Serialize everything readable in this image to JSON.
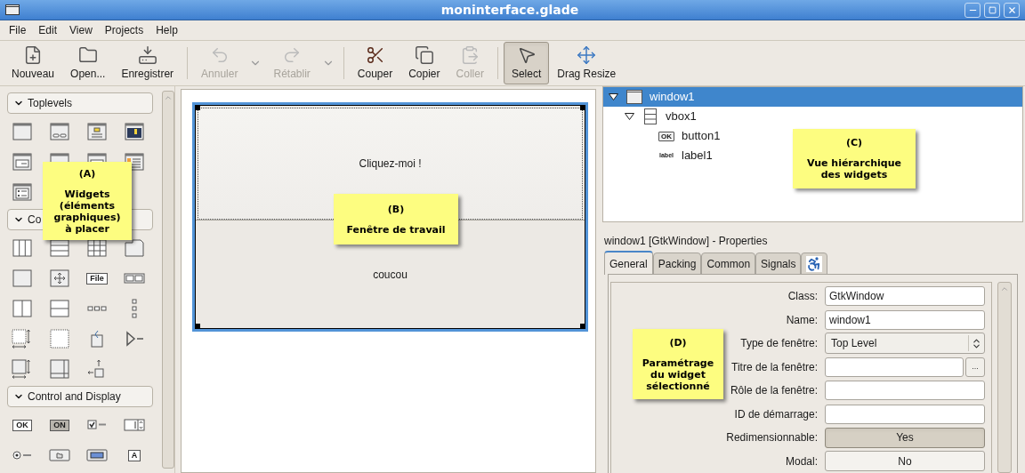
{
  "window": {
    "title": "moninterface.glade"
  },
  "menu": [
    "File",
    "Edit",
    "View",
    "Projects",
    "Help"
  ],
  "toolbar": [
    {
      "kind": "button",
      "label": "Nouveau",
      "disabled": false,
      "selected": false,
      "dropdown": false
    },
    {
      "kind": "button",
      "label": "Open...",
      "disabled": false,
      "selected": false,
      "dropdown": false
    },
    {
      "kind": "button",
      "label": "Enregistrer",
      "disabled": false,
      "selected": false,
      "dropdown": false
    },
    {
      "kind": "separator"
    },
    {
      "kind": "button",
      "label": "Annuler",
      "disabled": true,
      "selected": false,
      "dropdown": true
    },
    {
      "kind": "button",
      "label": "Rétablir",
      "disabled": true,
      "selected": false,
      "dropdown": true
    },
    {
      "kind": "separator"
    },
    {
      "kind": "button",
      "label": "Couper",
      "disabled": false,
      "selected": false,
      "dropdown": false
    },
    {
      "kind": "button",
      "label": "Copier",
      "disabled": false,
      "selected": false,
      "dropdown": false
    },
    {
      "kind": "button",
      "label": "Coller",
      "disabled": true,
      "selected": false,
      "dropdown": false
    },
    {
      "kind": "separator"
    },
    {
      "kind": "button",
      "label": "Select",
      "disabled": false,
      "selected": true,
      "dropdown": false
    },
    {
      "kind": "button",
      "label": "Drag Resize",
      "disabled": false,
      "selected": false,
      "dropdown": false
    }
  ],
  "palette": [
    {
      "title": "Toplevels",
      "expanded": true,
      "items": [
        {
          "kind": "window"
        },
        {
          "kind": "dialog"
        },
        {
          "kind": "message"
        },
        {
          "kind": "about"
        },
        {
          "kind": "form"
        },
        {
          "kind": "window"
        },
        {
          "kind": "form"
        },
        {
          "kind": "text-window"
        },
        {
          "kind": "list-window"
        }
      ]
    },
    {
      "title": "Co",
      "expanded": true,
      "items": [
        {
          "kind": "hbox"
        },
        {
          "kind": "vbox"
        },
        {
          "kind": "table"
        },
        {
          "kind": "notebook"
        },
        {
          "kind": "frame"
        },
        {
          "kind": "layout"
        },
        {
          "kind": "labeled",
          "text": "File"
        },
        {
          "kind": "toolbar"
        },
        {
          "kind": "hpaned"
        },
        {
          "kind": "vpaned"
        },
        {
          "kind": "hbuttons"
        },
        {
          "kind": "vbuttons"
        },
        {
          "kind": "dotted-resize"
        },
        {
          "kind": "dotted"
        },
        {
          "kind": "alignment"
        },
        {
          "kind": "expander"
        },
        {
          "kind": "fixed"
        },
        {
          "kind": "scrolled"
        },
        {
          "kind": "eventbox"
        }
      ]
    },
    {
      "title": "Control and Display",
      "expanded": true,
      "items": [
        {
          "kind": "labeled",
          "text": "OK"
        },
        {
          "kind": "pressed",
          "text": "ON"
        },
        {
          "kind": "check"
        },
        {
          "kind": "spin"
        },
        {
          "kind": "radio"
        },
        {
          "kind": "filechooser"
        },
        {
          "kind": "color"
        },
        {
          "kind": "labeled",
          "text": "A"
        }
      ]
    }
  ],
  "canvas": {
    "button": "Cliquez-moi !",
    "label": "coucou"
  },
  "tree": [
    {
      "label": "window1",
      "kind": "window",
      "selected": true,
      "expanded": true,
      "children": [
        {
          "label": "vbox1",
          "kind": "vbox",
          "selected": false,
          "expanded": true,
          "children": [
            {
              "label": "button1",
              "kind": "button",
              "icon_text": "OK",
              "selected": false
            },
            {
              "label": "label1",
              "kind": "label",
              "icon_text": "label",
              "selected": false
            }
          ]
        }
      ]
    }
  ],
  "properties": {
    "header": "window1 [GtkWindow] - Properties",
    "tabs": [
      {
        "kind": "text",
        "label": "General",
        "selected": true
      },
      {
        "kind": "text",
        "label": "Packing",
        "selected": false
      },
      {
        "kind": "text",
        "label": "Common",
        "selected": false
      },
      {
        "kind": "text",
        "label": "Signals",
        "selected": false
      },
      {
        "kind": "icon",
        "selected": false
      }
    ],
    "fields": [
      {
        "label": "Class:",
        "kind": "text",
        "value": "GtkWindow"
      },
      {
        "label": "Name:",
        "kind": "text",
        "value": "window1"
      },
      {
        "label": "Type de fenêtre:",
        "kind": "combo",
        "value": "Top Level"
      },
      {
        "label": "Titre de la fenêtre:",
        "kind": "text-button",
        "button": "..."
      },
      {
        "label": "Rôle de la fenêtre:",
        "kind": "text"
      },
      {
        "label": "ID de démarrage:",
        "kind": "text"
      },
      {
        "label": "Redimensionnable:",
        "kind": "toggle",
        "value": "Yes",
        "on": true
      },
      {
        "label": "Modal:",
        "kind": "toggle",
        "value": "No",
        "on": false
      }
    ]
  },
  "notes": [
    {
      "mark": "(A)",
      "text": "Widgets\n(éléments\ngraphiques)\nà placer"
    },
    {
      "mark": "(B)",
      "text": "Fenêtre de travail"
    },
    {
      "mark": "(C)",
      "text": "Vue hiérarchique\ndes widgets"
    },
    {
      "mark": "(D)",
      "text": "Paramétrage\ndu widget\nsélectionné"
    }
  ]
}
